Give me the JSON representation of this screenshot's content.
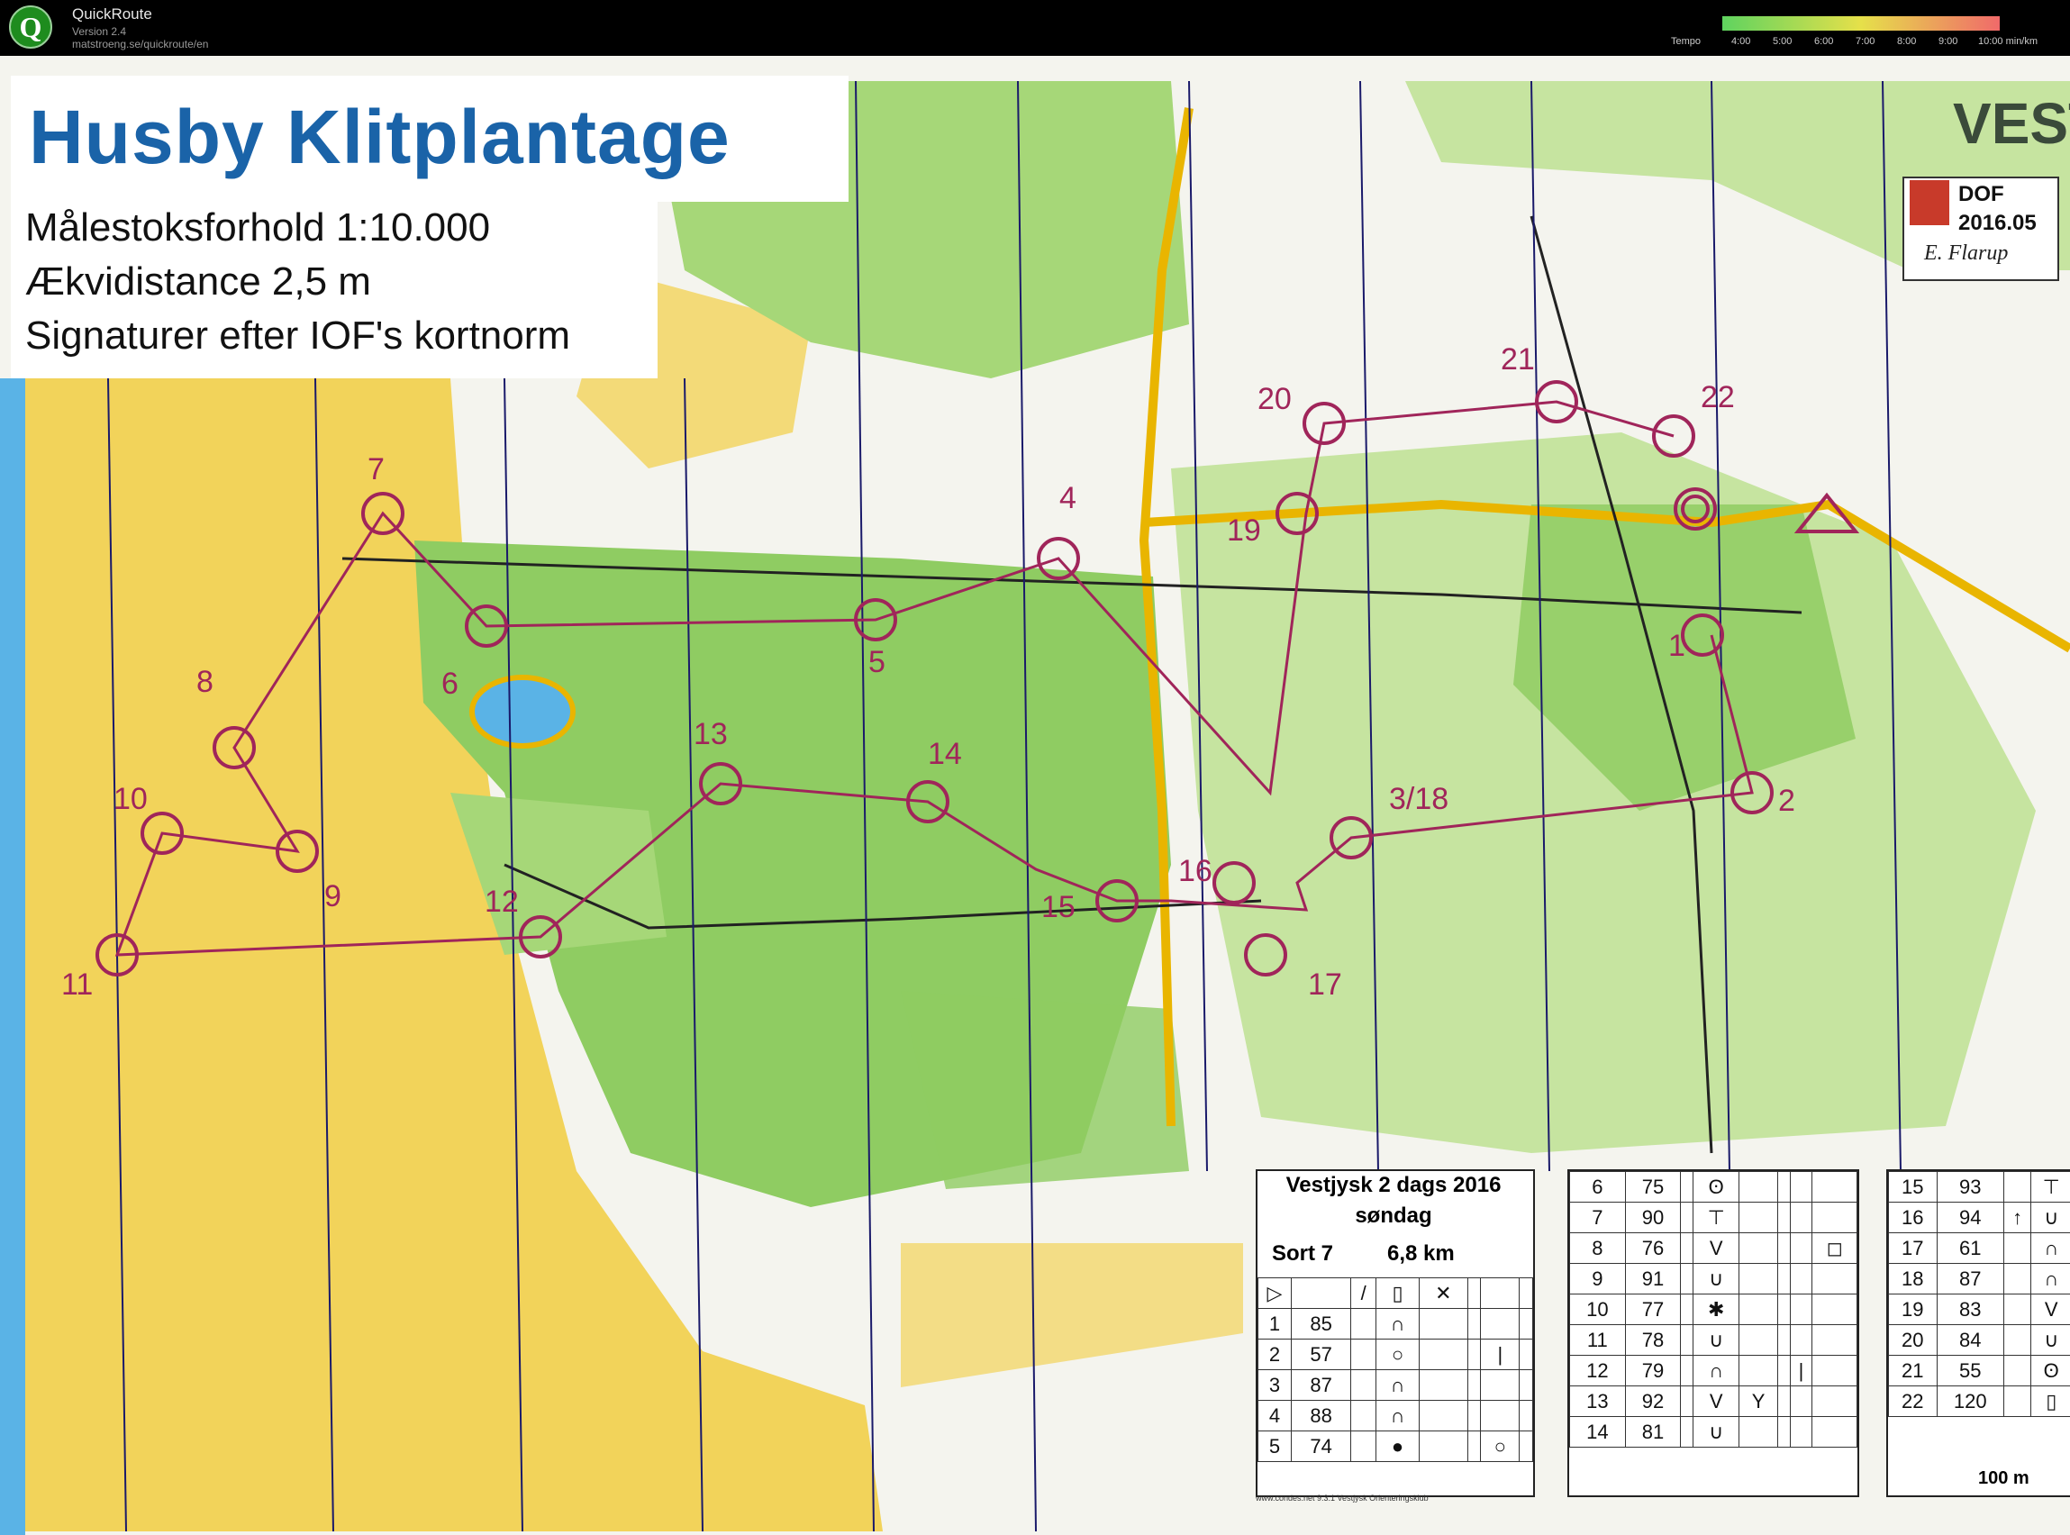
{
  "app": {
    "title": "QuickRoute",
    "version": "Version 2.4",
    "url": "matstroeng.se/quickroute/en",
    "tempo_label": "Tempo",
    "tempo_ticks": [
      "4:00",
      "5:00",
      "6:00",
      "7:00",
      "8:00",
      "9:00",
      "10:00 min/km"
    ]
  },
  "map": {
    "title": "Husby Klitplantage",
    "info": [
      "Målestoksforhold 1:10.000",
      "Ækvidistance 2,5 m",
      "Signaturer efter IOF's kortnorm"
    ],
    "corner_label": "VEST",
    "badge": {
      "org": "DOF",
      "year": "2016.05",
      "signature": "E. Flarup"
    },
    "colors": {
      "sand": "#f2d35a",
      "forest": "#8fcc62",
      "open_forest": "#c6e4a0",
      "water": "#5ab3e6",
      "course": "#a0255a",
      "road": "#e9b500"
    }
  },
  "controls": [
    {
      "label": "7"
    },
    {
      "label": "6"
    },
    {
      "label": "8"
    },
    {
      "label": "10"
    },
    {
      "label": "9"
    },
    {
      "label": "11"
    },
    {
      "label": "12"
    },
    {
      "label": "13"
    },
    {
      "label": "5"
    },
    {
      "label": "4"
    },
    {
      "label": "14"
    },
    {
      "label": "15"
    },
    {
      "label": "16"
    },
    {
      "label": "17"
    },
    {
      "label": "3/18"
    },
    {
      "label": "19"
    },
    {
      "label": "20"
    },
    {
      "label": "21"
    },
    {
      "label": "22"
    },
    {
      "label": "1"
    },
    {
      "label": "2"
    }
  ],
  "description": {
    "title": "Vestjysk 2 dags 2016",
    "day": "søndag",
    "course": "Sort 7",
    "length": "6,8 km",
    "footer": "www.condes.net 9.3.1 Vestjysk Orienteringsklub",
    "scale": "100 m",
    "rows_a": [
      [
        "1",
        "85"
      ],
      [
        "2",
        "57"
      ],
      [
        "3",
        "87"
      ],
      [
        "4",
        "88"
      ],
      [
        "5",
        "74"
      ]
    ],
    "rows_b": [
      [
        "6",
        "75"
      ],
      [
        "7",
        "90"
      ],
      [
        "8",
        "76"
      ],
      [
        "9",
        "91"
      ],
      [
        "10",
        "77"
      ],
      [
        "11",
        "78"
      ],
      [
        "12",
        "79"
      ],
      [
        "13",
        "92"
      ],
      [
        "14",
        "81"
      ]
    ],
    "rows_c": [
      [
        "15",
        "93"
      ],
      [
        "16",
        "94"
      ],
      [
        "17",
        "61"
      ],
      [
        "18",
        "87"
      ],
      [
        "19",
        "83"
      ],
      [
        "20",
        "84"
      ],
      [
        "21",
        "55"
      ],
      [
        "22",
        "120"
      ]
    ]
  }
}
